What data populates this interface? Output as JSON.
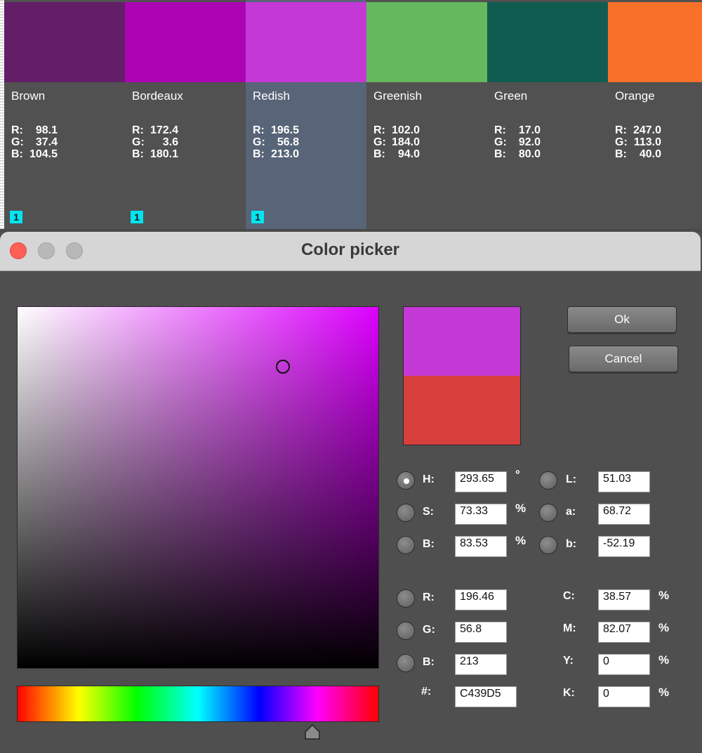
{
  "palette": {
    "swatches": [
      {
        "name": "Brown",
        "color": "#621f68",
        "r": "98.1",
        "g": "37.4",
        "b": "104.5",
        "badge": "1",
        "selected": false
      },
      {
        "name": "Bordeaux",
        "color": "#ac04b4",
        "r": "172.4",
        "g": "3.6",
        "b": "180.1",
        "badge": "1",
        "selected": false
      },
      {
        "name": "Redish",
        "color": "#c439d5",
        "r": "196.5",
        "g": "56.8",
        "b": "213.0",
        "badge": "1",
        "selected": true
      },
      {
        "name": "Greenish",
        "color": "#66b85e",
        "r": "102.0",
        "g": "184.0",
        "b": "94.0",
        "badge": "",
        "selected": false
      },
      {
        "name": "Green",
        "color": "#115c50",
        "r": "17.0",
        "g": "92.0",
        "b": "80.0",
        "badge": "",
        "selected": false
      },
      {
        "name": "Orange",
        "color": "#f77128",
        "r": "247.0",
        "g": "113.0",
        "b": "40.0",
        "badge": "",
        "selected": false
      }
    ],
    "labels": {
      "r": "R:",
      "g": "G:",
      "b": "B:"
    }
  },
  "dialog": {
    "title": "Color picker",
    "ok_label": "Ok",
    "cancel_label": "Cancel",
    "preview": {
      "new_color": "#c439d5",
      "old_color": "#d63f3c"
    },
    "hue_marker_fraction": 0.8157,
    "fields": {
      "h": {
        "label": "H:",
        "value": "293.65",
        "unit": "°"
      },
      "s": {
        "label": "S:",
        "value": "73.33",
        "unit": "%"
      },
      "bri": {
        "label": "B:",
        "value": "83.53",
        "unit": "%"
      },
      "l": {
        "label": "L:",
        "value": "51.03"
      },
      "a": {
        "label": "a:",
        "value": "68.72"
      },
      "lab_b": {
        "label": "b:",
        "value": "-52.19"
      },
      "r": {
        "label": "R:",
        "value": "196.46"
      },
      "g": {
        "label": "G:",
        "value": "56.8"
      },
      "blue": {
        "label": "B:",
        "value": "213"
      },
      "hex": {
        "label": "#:",
        "value": "C439D5"
      },
      "c": {
        "label": "C:",
        "value": "38.57",
        "unit": "%"
      },
      "m": {
        "label": "M:",
        "value": "82.07",
        "unit": "%"
      },
      "y": {
        "label": "Y:",
        "value": "0",
        "unit": "%"
      },
      "k": {
        "label": "K:",
        "value": "0",
        "unit": "%"
      }
    }
  }
}
